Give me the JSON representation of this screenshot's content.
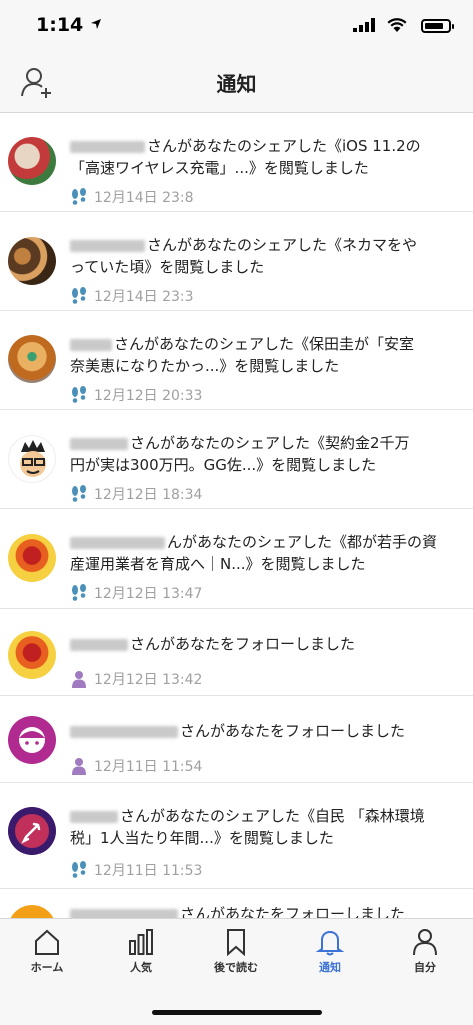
{
  "status_bar": {
    "time": "1:14"
  },
  "header": {
    "title": "通知"
  },
  "notifications": [
    {
      "type": "view",
      "text_line1": "さんがあなたのシェアした《iOS 11.2の",
      "text_line2": "「高速ワイヤレス充電」...》を閲覧しました",
      "time": "12月14日 23:8"
    },
    {
      "type": "view",
      "text_line1": "さんがあなたのシェアした《ネカマをや",
      "text_line2": "っていた頃》を閲覧しました",
      "time": "12月14日 23:3"
    },
    {
      "type": "view",
      "text_line1": "さんがあなたのシェアした《保田圭が「安室",
      "text_line2": "奈美恵になりたかっ...》を閲覧しました",
      "time": "12月12日 20:33"
    },
    {
      "type": "view",
      "text_line1": "さんがあなたのシェアした《契約金2千万",
      "text_line2": "円が実は300万円。GG佐...》を閲覧しました",
      "time": "12月12日 18:34"
    },
    {
      "type": "view",
      "text_line1": "んがあなたのシェアした《都が若手の資",
      "text_line2": "産運用業者を育成へ｜N...》を閲覧しました",
      "time": "12月12日 13:47"
    },
    {
      "type": "follow",
      "text_line1": "さんがあなたをフォローしました",
      "text_line2": "",
      "time": "12月12日 13:42"
    },
    {
      "type": "follow",
      "text_line1": "さんがあなたをフォローしました",
      "text_line2": "",
      "time": "12月11日 11:54"
    },
    {
      "type": "view",
      "text_line1": "さんがあなたのシェアした《自民 「森林環境",
      "text_line2": "税」1人当たり年間...》を閲覧しました",
      "time": "12月11日 11:53"
    },
    {
      "type": "follow",
      "text_line1": "さんがあなたをフォローしました",
      "text_line2": "",
      "time": ""
    }
  ],
  "tabs": [
    {
      "label": "ホーム",
      "icon": "home-icon"
    },
    {
      "label": "人気",
      "icon": "bar-chart-icon"
    },
    {
      "label": "後で読む",
      "icon": "bookmark-icon"
    },
    {
      "label": "通知",
      "icon": "bell-icon",
      "active": true
    },
    {
      "label": "自分",
      "icon": "person-icon"
    }
  ],
  "colors": {
    "accent": "#3b73d6",
    "view_icon": "#4a90b8",
    "follow_icon": "#a07bc0"
  }
}
